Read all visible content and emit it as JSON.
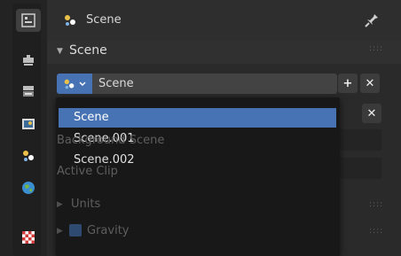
{
  "header": {
    "title": "Scene"
  },
  "panel": {
    "section_title": "Scene"
  },
  "scene_selector": {
    "value": "Scene",
    "add_label": "+",
    "remove_label": "✕"
  },
  "field_remove_label": "✕",
  "background": {
    "background_scene_label": "Background Scene",
    "active_clip_label": "Active Clip",
    "units_label": "Units",
    "gravity_label": "Gravity"
  },
  "dropdown": {
    "items": [
      {
        "label": "Scene"
      },
      {
        "label": "Scene.001"
      },
      {
        "label": "Scene.002"
      }
    ]
  },
  "icons": {
    "tabs": [
      "tool-icon",
      "render-icon",
      "output-icon",
      "view-layer-icon",
      "scene-icon",
      "world-icon",
      "texture-icon"
    ],
    "header": [
      "scene-icon",
      "pin-icon"
    ]
  },
  "colors": {
    "accent": "#4772b3",
    "bg": "#2b2b2b",
    "popup": "#181818"
  }
}
